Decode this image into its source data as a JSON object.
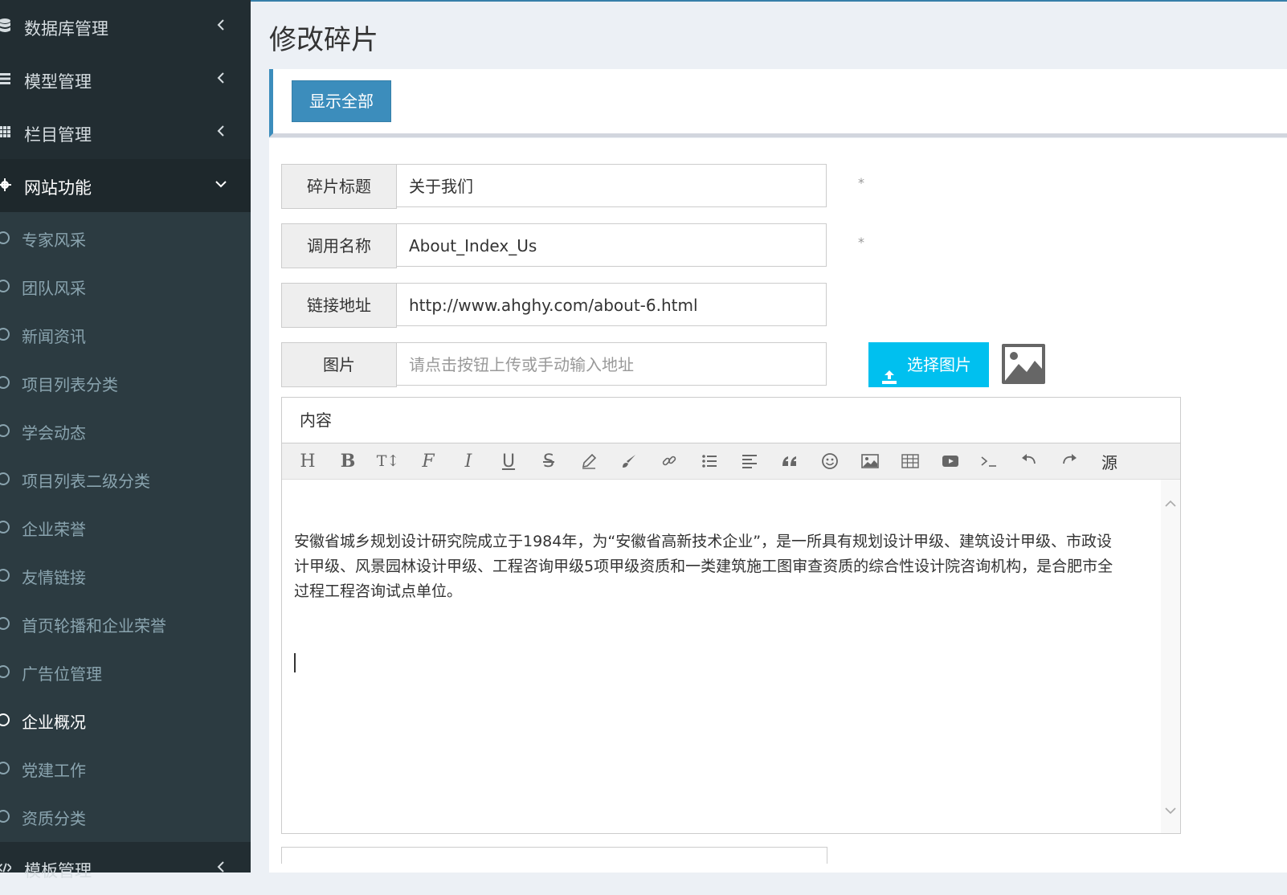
{
  "sidebar": {
    "groups": [
      {
        "label": "数据库管理"
      },
      {
        "label": "模型管理"
      },
      {
        "label": "栏目管理"
      },
      {
        "label": "网站功能"
      }
    ],
    "subitems": [
      {
        "label": "专家风采"
      },
      {
        "label": "团队风采"
      },
      {
        "label": "新闻资讯"
      },
      {
        "label": "项目列表分类"
      },
      {
        "label": "学会动态"
      },
      {
        "label": "项目列表二级分类"
      },
      {
        "label": "企业荣誉"
      },
      {
        "label": "友情链接"
      },
      {
        "label": "首页轮播和企业荣誉"
      },
      {
        "label": "广告位管理"
      },
      {
        "label": "企业概况"
      },
      {
        "label": "党建工作"
      },
      {
        "label": "资质分类"
      }
    ],
    "last_group": {
      "label": "模板管理"
    }
  },
  "page": {
    "title": "修改碎片",
    "show_all_button": "显示全部"
  },
  "form": {
    "title_label": "碎片标题",
    "title_value": "关于我们",
    "call_name_label": "调用名称",
    "call_name_value": "About_Index_Us",
    "link_label": "链接地址",
    "link_value": "http://www.ahghy.com/about-6.html",
    "image_label": "图片",
    "image_placeholder": "请点击按钮上传或手动输入地址",
    "upload_button": "选择图片",
    "required_mark": "*"
  },
  "editor": {
    "header": "内容",
    "toolbar": {
      "heading": "H",
      "bold": "B",
      "font_size": "T↕",
      "font_family": "F",
      "italic": "I",
      "underline": "U",
      "strike": "S",
      "source": "源"
    },
    "content": "安徽省城乡规划设计研究院成立于1984年，为“安徽省高新技术企业”，是一所具有规划设计甲级、建筑设计甲级、市政设计甲级、风景园林设计甲级、工程咨询甲级5项甲级资质和一类建筑施工图审查资质的综合性设计院咨询机构，是合肥市全过程工程咨询试点单位。"
  },
  "colors": {
    "sidebar_bg": "#222d32",
    "primary": "#3c8dbc",
    "info": "#00c0ef"
  }
}
